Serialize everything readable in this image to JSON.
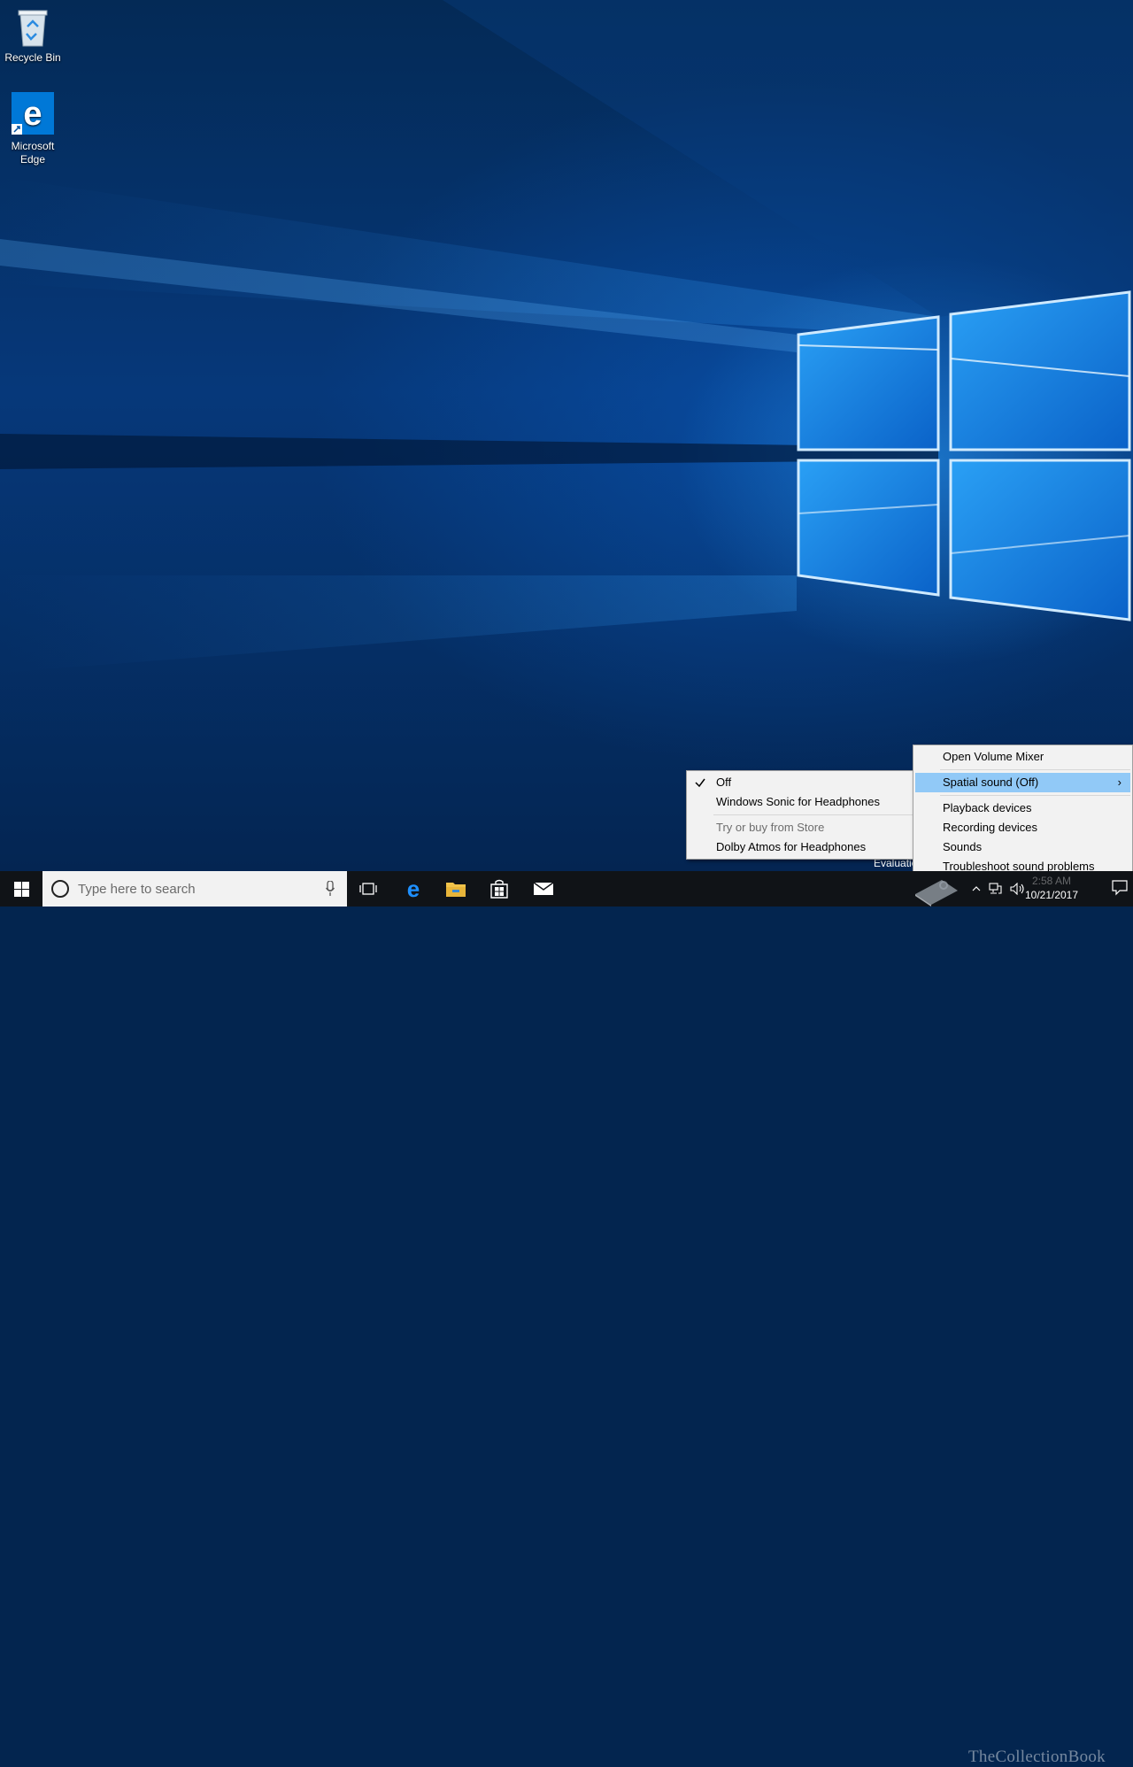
{
  "desktop": {
    "icons": [
      {
        "label": "Recycle Bin",
        "icon": "recycle-bin-icon"
      },
      {
        "label": "Microsoft Edge",
        "icon": "edge-icon"
      }
    ],
    "evaluation_text": "Evaluatio",
    "watermark": "TheCollectionBook"
  },
  "taskbar": {
    "search_placeholder": "Type here to search",
    "pinned": [
      "task-view-icon",
      "edge-icon",
      "file-explorer-icon",
      "store-icon",
      "mail-icon"
    ],
    "tray_icons": [
      "show-hidden-icons-chevron",
      "network-icon",
      "volume-icon"
    ],
    "time": "2:58 AM",
    "date": "10/21/2017"
  },
  "context_menu": {
    "items": [
      {
        "label": "Open Volume Mixer"
      },
      {
        "label": "Spatial sound (Off)",
        "highlighted": true,
        "submenu": true
      },
      {
        "label": "Playback devices"
      },
      {
        "label": "Recording devices"
      },
      {
        "label": "Sounds"
      },
      {
        "label": "Troubleshoot sound problems"
      }
    ]
  },
  "spatial_submenu": {
    "items": [
      {
        "label": "Off",
        "checked": true
      },
      {
        "label": "Windows Sonic for Headphones"
      },
      {
        "label": "Try or buy from Store",
        "disabled": true
      },
      {
        "label": "Dolby Atmos for Headphones"
      }
    ]
  },
  "colors": {
    "accent": "#0078d7",
    "menu_highlight": "#91c9f7",
    "taskbar": "#101317"
  }
}
